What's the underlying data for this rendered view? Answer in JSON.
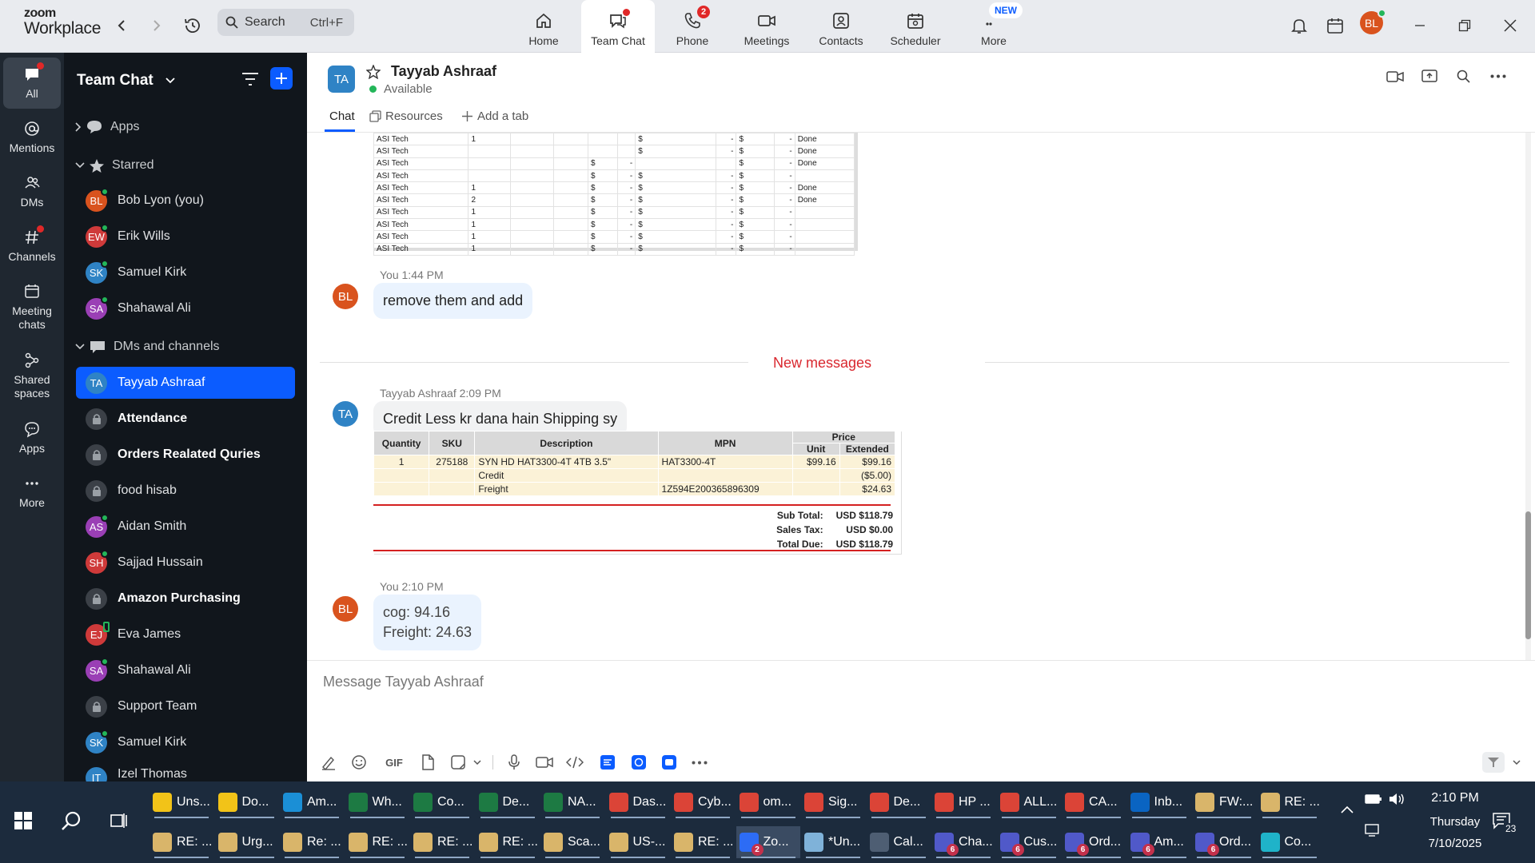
{
  "topbar": {
    "logo_line1": "zoom",
    "logo_line2": "Workplace",
    "search_label": "Search",
    "search_shortcut": "Ctrl+F",
    "tabs": [
      {
        "label": "Home",
        "icon": "home-icon"
      },
      {
        "label": "Team Chat",
        "icon": "chat-icon"
      },
      {
        "label": "Phone",
        "icon": "phone-icon",
        "badge": "2"
      },
      {
        "label": "Meetings",
        "icon": "video-icon"
      },
      {
        "label": "Contacts",
        "icon": "contacts-icon"
      },
      {
        "label": "Scheduler",
        "icon": "calendar-icon"
      },
      {
        "label": "More",
        "icon": "more-icon",
        "badge": "NEW"
      }
    ],
    "user_initials": "BL"
  },
  "rail": [
    {
      "label": "All"
    },
    {
      "label": "Mentions"
    },
    {
      "label": "DMs"
    },
    {
      "label": "Channels"
    },
    {
      "label": "Meeting chats"
    },
    {
      "label": "Shared spaces"
    },
    {
      "label": "Apps"
    },
    {
      "label": "More"
    }
  ],
  "sidebar": {
    "title": "Team Chat",
    "apps_label": "Apps",
    "starred_label": "Starred",
    "starred": [
      {
        "initials": "BL",
        "name": "Bob Lyon (you)",
        "color": "#d9531e"
      },
      {
        "initials": "EW",
        "name": "Erik Wills",
        "color": "#cf3a3a"
      },
      {
        "initials": "SK",
        "name": "Samuel Kirk",
        "color": "#2f83c5"
      },
      {
        "initials": "SA",
        "name": "Shahawal Ali",
        "color": "#9a3fb5"
      }
    ],
    "dms_label": "DMs and channels",
    "dms": [
      {
        "initials": "TA",
        "name": "Tayyab Ashraaf",
        "color": "#2f83c5",
        "active": true
      },
      {
        "name": "Attendance",
        "lock": true,
        "bold": true
      },
      {
        "name": "Orders Realated Quries",
        "lock": true,
        "bold": true
      },
      {
        "name": "food hisab",
        "lock": true
      },
      {
        "initials": "AS",
        "name": "Aidan Smith",
        "color": "#9a3fb5"
      },
      {
        "initials": "SH",
        "name": "Sajjad Hussain",
        "color": "#cf3a3a"
      },
      {
        "name": "Amazon Purchasing",
        "lock": true,
        "bold": true
      },
      {
        "initials": "EJ",
        "name": "Eva James",
        "color": "#cf3a3a"
      },
      {
        "initials": "SA",
        "name": "Shahawal Ali",
        "color": "#9a3fb5"
      },
      {
        "name": "Support Team",
        "lock": true
      },
      {
        "initials": "SK",
        "name": "Samuel Kirk",
        "color": "#2f83c5"
      },
      {
        "initials": "IT",
        "name": "Izel Thomas",
        "color": "#2f83c5"
      }
    ]
  },
  "chat": {
    "contact_initials": "TA",
    "contact_name": "Tayyab Ashraaf",
    "status": "Available",
    "tabs": [
      "Chat",
      "Resources",
      "Add a tab"
    ],
    "sheet_rows": [
      [
        "ASI Tech",
        "1",
        "",
        "",
        "",
        "",
        "$",
        "-",
        "$",
        "-",
        "Done"
      ],
      [
        "ASI Tech",
        "",
        "",
        "",
        "",
        "",
        "$",
        "-",
        "$",
        "-",
        "Done"
      ],
      [
        "ASI Tech",
        "",
        "",
        "",
        "$",
        "-",
        "",
        "",
        "$",
        "-",
        "Done"
      ],
      [
        "ASI Tech",
        "",
        "",
        "",
        "$",
        "-",
        "$",
        "-",
        "$",
        "-",
        ""
      ],
      [
        "ASI Tech",
        "1",
        "",
        "",
        "$",
        "-",
        "$",
        "-",
        "$",
        "-",
        "Done"
      ],
      [
        "ASI Tech",
        "2",
        "",
        "",
        "$",
        "-",
        "$",
        "-",
        "$",
        "-",
        "Done"
      ],
      [
        "ASI Tech",
        "1",
        "",
        "",
        "$",
        "-",
        "$",
        "-",
        "$",
        "-",
        ""
      ],
      [
        "ASI Tech",
        "1",
        "",
        "",
        "$",
        "-",
        "$",
        "-",
        "$",
        "-",
        ""
      ],
      [
        "ASI Tech",
        "1",
        "",
        "",
        "$",
        "-",
        "$",
        "-",
        "$",
        "-",
        ""
      ],
      [
        "ASI Tech",
        "1",
        "",
        "",
        "$",
        "-",
        "$",
        "-",
        "$",
        "-",
        ""
      ]
    ],
    "msg1": {
      "sender": "You",
      "time": "1:44 PM",
      "initials": "BL",
      "text": "remove them and add"
    },
    "new_messages_label": "New messages",
    "msg2": {
      "sender": "Tayyab Ashraaf",
      "time": "2:09 PM",
      "initials": "TA",
      "text": "Credit Less kr dana hain Shipping sy"
    },
    "invoice": {
      "headers": [
        "Quantity",
        "SKU",
        "Description",
        "MPN",
        "Price",
        "Unit",
        "Extended"
      ],
      "rows": [
        [
          "1",
          "275188",
          "SYN HD HAT3300-4T 4TB 3.5\"",
          "HAT3300-4T",
          "$99.16",
          "$99.16"
        ],
        [
          "",
          "",
          "Credit",
          "",
          "",
          "($5.00)"
        ],
        [
          "",
          "",
          "Freight",
          "1Z594E200365896309",
          "",
          "$24.63"
        ]
      ],
      "totals": [
        {
          "label": "Sub Total:",
          "value": "USD $118.79"
        },
        {
          "label": "Sales Tax:",
          "value": "USD $0.00"
        },
        {
          "label": "Total Due:",
          "value": "USD $118.79"
        }
      ]
    },
    "msg3": {
      "sender": "You",
      "time": "2:10 PM",
      "initials": "BL",
      "line1": "cog: 94.16",
      "line2": "Freight: 24.63"
    },
    "composer_placeholder": "Message Tayyab Ashraaf",
    "gif_label": "GIF"
  },
  "taskbar": {
    "row1": [
      {
        "label": "Uns...",
        "color": "#f2c318"
      },
      {
        "label": "Do...",
        "color": "#f2c318"
      },
      {
        "label": "Am...",
        "color": "#1b8fd6"
      },
      {
        "label": "Wh...",
        "color": "#1d7a43"
      },
      {
        "label": "Co...",
        "color": "#1d7a43"
      },
      {
        "label": "De...",
        "color": "#1d7a43"
      },
      {
        "label": "NA...",
        "color": "#1d7a43"
      },
      {
        "label": "Das...",
        "color": "#db4437"
      },
      {
        "label": "Cyb...",
        "color": "#db4437"
      },
      {
        "label": "om...",
        "color": "#db4437"
      },
      {
        "label": "Sig...",
        "color": "#db4437"
      },
      {
        "label": "De...",
        "color": "#db4437"
      },
      {
        "label": "HP ...",
        "color": "#db4437"
      },
      {
        "label": "ALL...",
        "color": "#db4437"
      },
      {
        "label": "CA...",
        "color": "#db4437"
      },
      {
        "label": "Inb...",
        "color": "#0a64c2"
      },
      {
        "label": "FW:...",
        "color": "#d9b56a"
      },
      {
        "label": "RE: ...",
        "color": "#d9b56a"
      }
    ],
    "row2": [
      {
        "label": "RE: ...",
        "color": "#d9b56a"
      },
      {
        "label": "Urg...",
        "color": "#d9b56a"
      },
      {
        "label": "Re: ...",
        "color": "#d9b56a"
      },
      {
        "label": "RE: ...",
        "color": "#d9b56a"
      },
      {
        "label": "RE: ...",
        "color": "#d9b56a"
      },
      {
        "label": "RE: ...",
        "color": "#d9b56a"
      },
      {
        "label": "Sca...",
        "color": "#d9b56a"
      },
      {
        "label": "US-...",
        "color": "#d9b56a"
      },
      {
        "label": "RE: ...",
        "color": "#d9b56a"
      },
      {
        "label": "Zo...",
        "color": "#2d6cf5",
        "active": true,
        "badge": "2"
      },
      {
        "label": "*Un...",
        "color": "#7fb2d9"
      },
      {
        "label": "Cal...",
        "color": "#4e5e73"
      },
      {
        "label": "Cha...",
        "color": "#5059c9",
        "badge": "6"
      },
      {
        "label": "Cus...",
        "color": "#5059c9",
        "badge": "6"
      },
      {
        "label": "Ord...",
        "color": "#5059c9",
        "badge": "6"
      },
      {
        "label": "Am...",
        "color": "#5059c9",
        "badge": "6"
      },
      {
        "label": "Ord...",
        "color": "#5059c9",
        "badge": "6"
      },
      {
        "label": "Co...",
        "color": "#1fb3c9"
      }
    ],
    "time": "2:10 PM",
    "day": "Thursday",
    "date": "7/10/2025",
    "notifications": "23"
  }
}
